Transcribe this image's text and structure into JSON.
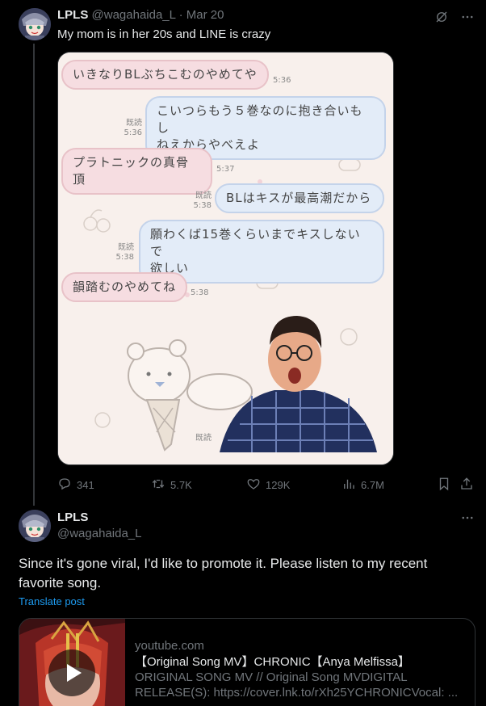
{
  "tweet1": {
    "display_name": "LPLS",
    "handle": "@wagahaida_L",
    "separator": "·",
    "date": "Mar 20",
    "text": "My mom is in her 20s and LINE is crazy",
    "chat": {
      "read_label": "既読",
      "messages": [
        {
          "side": "left",
          "text": "いきなりBLぶちこむのやめてや",
          "time": "5:36"
        },
        {
          "side": "right",
          "text_line1": "こいつらもう５巻なのに抱き合いもし",
          "text_line2": "ねえからやべえよ",
          "time": "5:36"
        },
        {
          "side": "left",
          "text": "プラトニックの真骨頂",
          "time": "5:37"
        },
        {
          "side": "right",
          "text": "BLはキスが最高潮だから",
          "time": "5:38"
        },
        {
          "side": "right",
          "text_line1": "願わくば15巻くらいまでキスしないで",
          "text_line2": "欲しい",
          "time": "5:38"
        },
        {
          "side": "left",
          "text": "韻踏むのやめてね",
          "time": "5:38"
        }
      ]
    },
    "stats": {
      "replies": "341",
      "reposts": "5.7K",
      "likes": "129K",
      "views": "6.7M"
    }
  },
  "tweet2": {
    "display_name": "LPLS",
    "handle": "@wagahaida_L",
    "text": "Since it's gone viral, I'd like to promote it. Please listen to my recent favorite song.",
    "translate_label": "Translate post",
    "card": {
      "domain": "youtube.com",
      "title": "【Original Song MV】CHRONIC【Anya Melfissa】",
      "description": "ORIGINAL SONG MV // Original Song MVDIGITAL RELEASE(S): https://cover.lnk.to/rXh25YCHRONICVocal: ..."
    }
  },
  "colors": {
    "background": "#000000",
    "text": "#e7e9ea",
    "muted": "#71767b",
    "link": "#1d9bf0",
    "bubble_left": "#f6dde1",
    "bubble_right": "#e3ecf8"
  },
  "icons": [
    "grok-icon",
    "more-icon",
    "reply-icon",
    "repost-icon",
    "like-icon",
    "views-icon",
    "bookmark-icon",
    "share-icon",
    "play-icon"
  ]
}
